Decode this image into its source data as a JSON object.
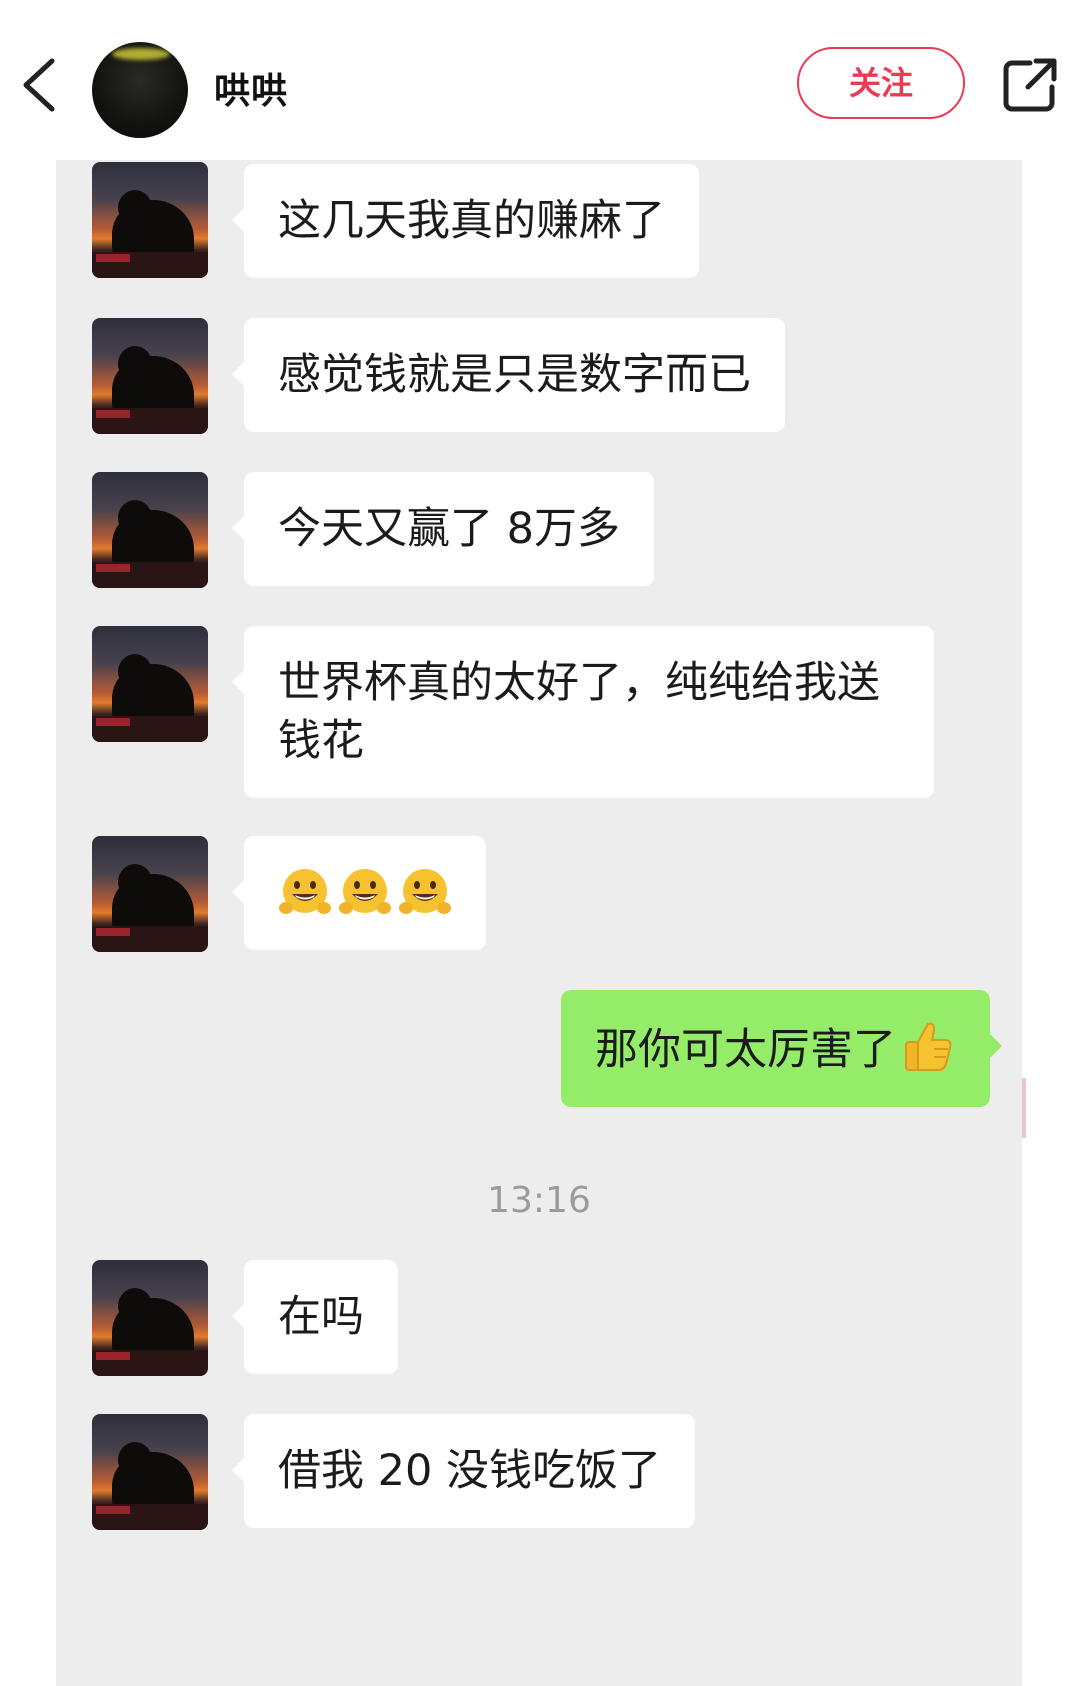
{
  "header": {
    "username": "哄哄",
    "follow_label": "关注",
    "back_icon": "chevron-left-icon",
    "share_icon": "share-icon"
  },
  "colors": {
    "follow_accent": "#ea3b54",
    "my_bubble": "#95ec69",
    "their_bubble": "#ffffff",
    "chat_background": "#ededed"
  },
  "messages": [
    {
      "sender": "other",
      "text": "这几天我真的赚麻了"
    },
    {
      "sender": "other",
      "text": "感觉钱就是只是数字而已"
    },
    {
      "sender": "other",
      "text": "今天又赢了 8万多"
    },
    {
      "sender": "other",
      "text": "世界杯真的太好了，纯纯给我送钱花"
    },
    {
      "sender": "other",
      "emojis": [
        "grinning-emoji",
        "grinning-emoji",
        "grinning-emoji"
      ]
    },
    {
      "sender": "me",
      "text": "那你可太厉害了",
      "emoji": "thumbs-up-emoji"
    },
    {
      "sender": "other",
      "text": "在吗"
    },
    {
      "sender": "other",
      "text": "借我 20 没钱吃饭了"
    }
  ],
  "timestamp": "13:16"
}
